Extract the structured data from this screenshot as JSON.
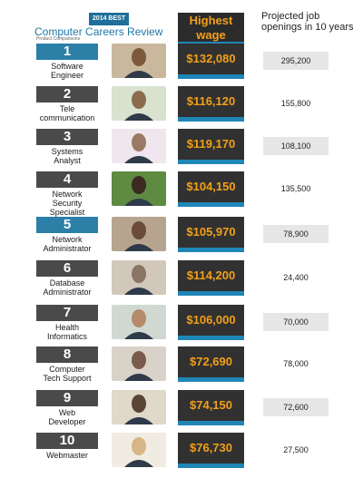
{
  "header": {
    "badge": "2014 BEST",
    "title": "Computer Careers Review",
    "subtitle": "Product Comparisons"
  },
  "columns": {
    "wage_label": [
      "Highest",
      "wage"
    ],
    "projection_label": "Projected job openings in 10 years"
  },
  "rows": [
    {
      "rank": "1",
      "job": [
        "Software",
        "Engineer"
      ],
      "wage": "$132,080",
      "openings": "295,200",
      "highlight": true,
      "shade": true
    },
    {
      "rank": "2",
      "job": [
        "Tele",
        "communication"
      ],
      "wage": "$116,120",
      "openings": "155,800",
      "highlight": false,
      "shade": false
    },
    {
      "rank": "3",
      "job": [
        "Systems",
        "Analyst"
      ],
      "wage": "$119,170",
      "openings": "108,100",
      "highlight": false,
      "shade": true
    },
    {
      "rank": "4",
      "job": [
        "Network",
        "Security",
        "Specialist"
      ],
      "wage": "$104,150",
      "openings": "135,500",
      "highlight": false,
      "shade": false
    },
    {
      "rank": "5",
      "job": [
        "Network",
        "Administrator"
      ],
      "wage": "$105,970",
      "openings": "78,900",
      "highlight": true,
      "shade": true
    },
    {
      "rank": "6",
      "job": [
        "Database",
        "Administrator"
      ],
      "wage": "$114,200",
      "openings": "24,400",
      "highlight": false,
      "shade": false
    },
    {
      "rank": "7",
      "job": [
        "Health",
        "Informatics"
      ],
      "wage": "$106,000",
      "openings": "70,000",
      "highlight": false,
      "shade": true
    },
    {
      "rank": "8",
      "job": [
        "Computer",
        "Tech Support"
      ],
      "wage": "$72,690",
      "openings": "78,000",
      "highlight": false,
      "shade": false
    },
    {
      "rank": "9",
      "job": [
        "Web",
        "Developer"
      ],
      "wage": "$74,150",
      "openings": "72,600",
      "highlight": false,
      "shade": true
    },
    {
      "rank": "10",
      "job": [
        "Webmaster"
      ],
      "wage": "$76,730",
      "openings": "27,500",
      "highlight": false,
      "shade": false
    }
  ],
  "colors": {
    "wage_text": "#f3a019",
    "wage_bg": "#313131",
    "accent_blue": "#1f86b7",
    "rank_dark": "#4a4a4a",
    "rank_highlight": "#2c7fa7"
  }
}
